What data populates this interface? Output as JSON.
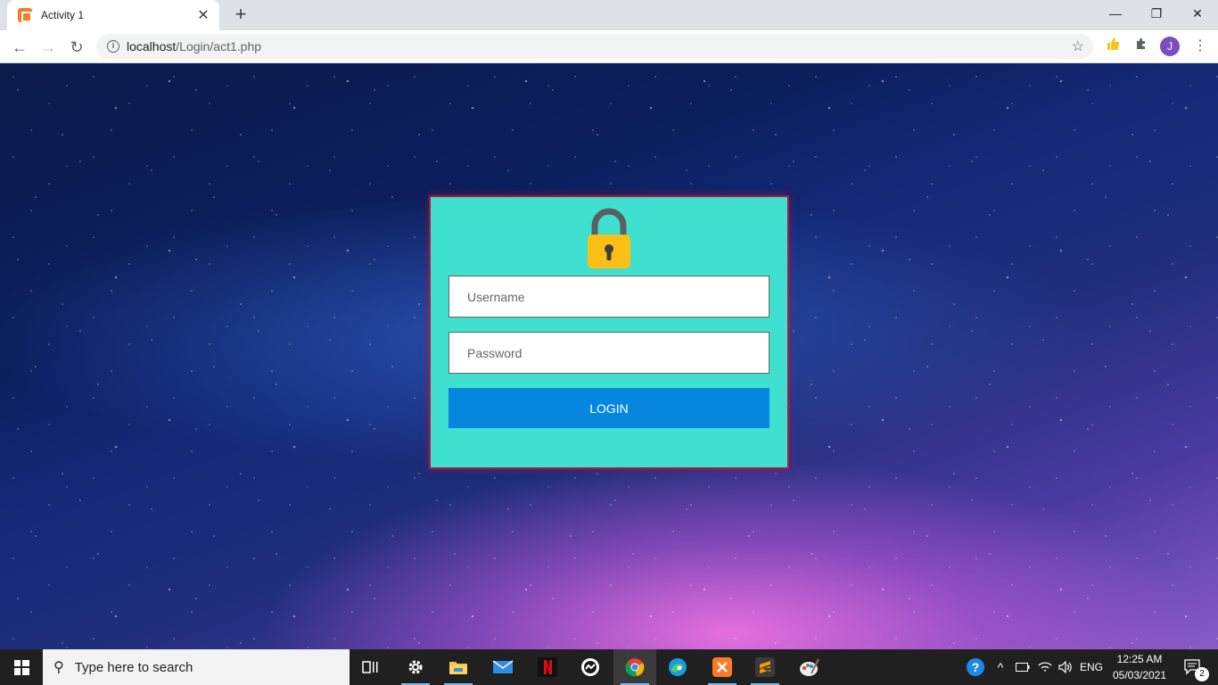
{
  "browser": {
    "tab_title": "Activity 1",
    "tab_close": "✕",
    "new_tab": "+",
    "minimize": "—",
    "restore": "❐",
    "close": "✕",
    "url_host": "localhost",
    "url_path": "/Login/act1.php",
    "avatar_letter": "J",
    "back": "←",
    "forward": "→",
    "reload": "↻",
    "star": "☆",
    "menu": "⋮"
  },
  "login": {
    "username_placeholder": "Username",
    "password_placeholder": "Password",
    "button_label": "LOGIN",
    "card_color": "#40e0d0",
    "button_color": "#0587e0"
  },
  "taskbar": {
    "search_placeholder": "Type here to search",
    "time": "12:25 AM",
    "date": "05/03/2021",
    "language": "ENG",
    "notification_count": "2",
    "apps": [
      "task-view",
      "settings",
      "file-explorer",
      "mail",
      "netflix",
      "messenger",
      "chrome",
      "edge",
      "xampp",
      "sublime-text",
      "paint"
    ]
  }
}
